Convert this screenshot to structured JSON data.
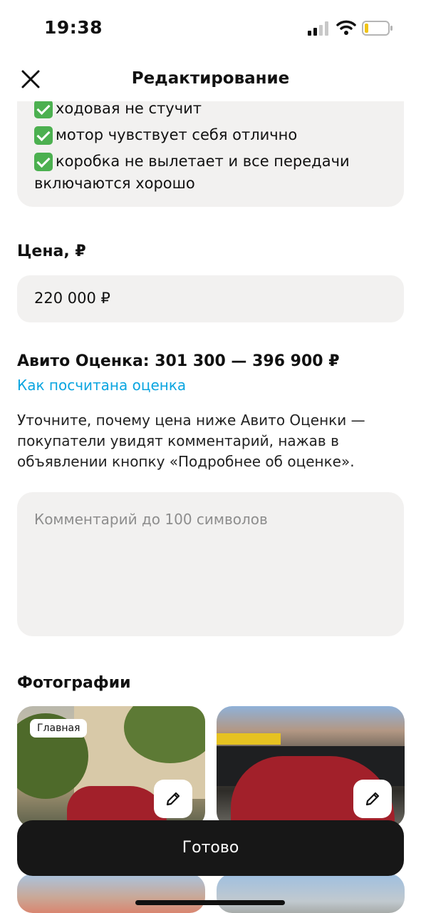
{
  "status_bar": {
    "time": "19:38"
  },
  "nav": {
    "title": "Редактирование"
  },
  "description": {
    "lines": [
      "ходовая не стучит",
      "мотор чувствует себя отлично",
      "коробка не вылетает и все передачи",
      "включаются хорошо"
    ]
  },
  "price": {
    "label": "Цена, ₽",
    "value": "220 000 ₽"
  },
  "avito_estimate": {
    "title": "Авито Оценка: 301 300 — 396 900 ₽",
    "link": "Как посчитана оценка",
    "hint": "Уточните, почему цена ниже Авито Оценки — покупатели увидят комментарий, нажав в объявлении кнопку «Подробнее об оценке»."
  },
  "comment": {
    "placeholder": "Комментарий до 100 символов",
    "value": ""
  },
  "photos": {
    "label": "Фотографии",
    "main_badge": "Главная"
  },
  "done_button": {
    "label": "Готово"
  },
  "colors": {
    "accent_link": "#0aa5e0",
    "button_dark": "#171717",
    "field_bg": "#f2f1f0"
  }
}
